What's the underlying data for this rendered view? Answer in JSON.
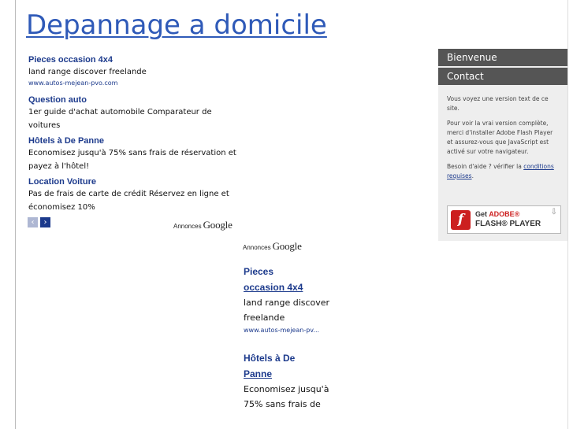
{
  "page": {
    "title": "Depannage a domicile"
  },
  "ads_horizontal": {
    "items": [
      {
        "title": "Pieces occasion 4x4",
        "text": "land range discover freelande",
        "url": "www.autos-mejean-pvo.com"
      },
      {
        "title": "Question auto",
        "text": "1er guide d'achat automobile Comparateur de voitures"
      },
      {
        "title": "Hôtels à De Panne",
        "text": "Economisez jusqu'à 75% sans frais de réservation et payez à l'hôtel!"
      },
      {
        "title": "Location Voiture",
        "text": "Pas de frais de carte de crédit Réservez en ligne et économisez 10%"
      }
    ],
    "prev_glyph": "‹",
    "next_glyph": "›",
    "ads_by_label": "Annonces",
    "ads_by_brand": "Google"
  },
  "ads_vertical": {
    "ads_by_label": "Annonces",
    "ads_by_brand": "Google",
    "items": [
      {
        "title_line1": "Pieces",
        "title_line2": "occasion 4x4",
        "text": "land range discover freelande",
        "url": "www.autos-mejean-pv..."
      },
      {
        "title_line1": "Hôtels à De",
        "title_line2": "Panne",
        "text": "Economisez jusqu'à 75% sans frais de"
      }
    ]
  },
  "sidebar": {
    "menu": [
      {
        "label": "Bienvenue"
      },
      {
        "label": "Contact"
      }
    ],
    "notice_1": "Vous voyez une version text de ce site.",
    "notice_2": "Pour voir la vrai version complète, merci d'installer Adobe Flash Player et assurez-vous que JavaScript est activé sur votre navigateur.",
    "notice_3_prefix": "Besoin d'aide ? vérifier la",
    "notice_3_link": "conditions requises",
    "notice_3_suffix": ".",
    "flash_badge": {
      "logo_glyph": "f",
      "get_text": "Get",
      "brand_text": "ADOBE®",
      "player_text": "FLASH® PLAYER",
      "arrow_glyph": "⇩"
    }
  },
  "colors": {
    "title_blue": "#2f5ab8",
    "link_blue": "#1c3a8c",
    "menu_bg": "#555555",
    "sidebar_bg": "#eeeeee",
    "flash_red": "#cc1f1f"
  }
}
